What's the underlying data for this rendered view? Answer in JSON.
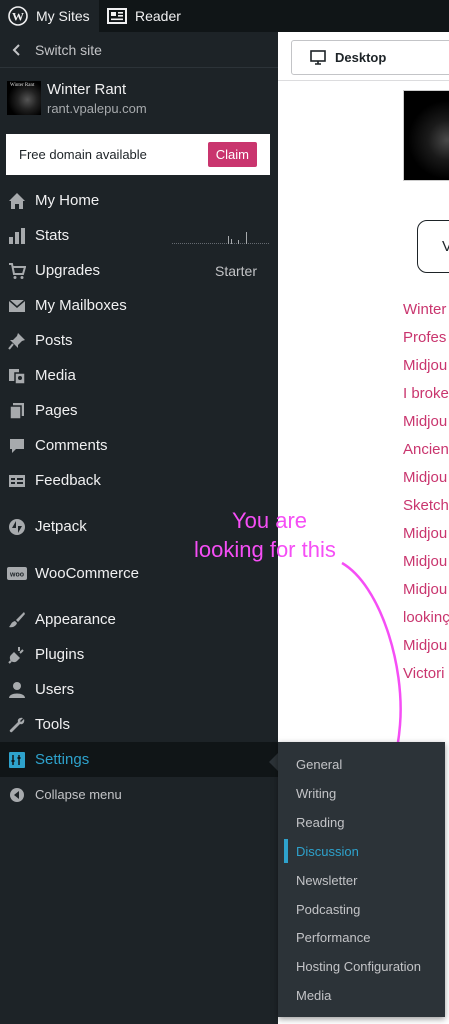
{
  "topbar": {
    "my_sites": "My Sites",
    "reader": "Reader"
  },
  "sidebar": {
    "switch_site": "Switch site",
    "site_name": "Winter Rant",
    "site_url": "rant.vpalepu.com",
    "site_thumb_text": "Winter Rant",
    "domain_card": {
      "text": "Free domain available",
      "claim": "Claim"
    },
    "items": [
      {
        "label": "My Home",
        "icon": "home-icon"
      },
      {
        "label": "Stats",
        "icon": "stats-icon"
      },
      {
        "label": "Upgrades",
        "icon": "cart-icon",
        "aside": "Starter"
      },
      {
        "label": "My Mailboxes",
        "icon": "mail-icon"
      },
      {
        "label": "Posts",
        "icon": "pin-icon"
      },
      {
        "label": "Media",
        "icon": "media-icon"
      },
      {
        "label": "Pages",
        "icon": "pages-icon"
      },
      {
        "label": "Comments",
        "icon": "comment-icon"
      },
      {
        "label": "Feedback",
        "icon": "feedback-icon"
      },
      {
        "label": "Jetpack",
        "icon": "jetpack-icon"
      },
      {
        "label": "WooCommerce",
        "icon": "woo-icon"
      },
      {
        "label": "Appearance",
        "icon": "brush-icon"
      },
      {
        "label": "Plugins",
        "icon": "plug-icon"
      },
      {
        "label": "Users",
        "icon": "user-icon"
      },
      {
        "label": "Tools",
        "icon": "wrench-icon"
      },
      {
        "label": "Settings",
        "icon": "settings-icon"
      },
      {
        "label": "Collapse menu",
        "icon": "collapse-icon"
      }
    ]
  },
  "preview": {
    "device": "Desktop",
    "button_text": "V",
    "posts": [
      "Winter",
      "Profes",
      "Midjou",
      "I broke",
      "Midjou",
      "Ancien",
      "Midjou",
      "Sketch",
      "Midjou",
      "Midjou",
      "Midjou",
      "lookinç",
      "Midjou",
      "Victori"
    ]
  },
  "annotation": {
    "line1": "You are",
    "line2": "looking for this"
  },
  "settings_submenu": {
    "items": [
      "General",
      "Writing",
      "Reading",
      "Discussion",
      "Newsletter",
      "Podcasting",
      "Performance",
      "Hosting Configuration",
      "Media"
    ],
    "active": "Discussion"
  },
  "colors": {
    "accent": "#2ea2cc",
    "brand_pink": "#c9356e",
    "annotation": "#f54ef5",
    "sidebar_bg": "#1d2327"
  }
}
